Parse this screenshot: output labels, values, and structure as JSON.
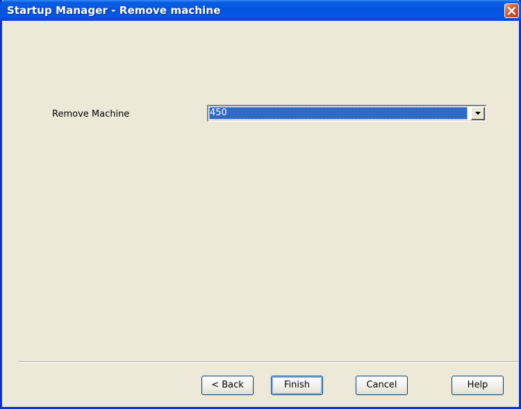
{
  "window": {
    "title": "Startup Manager - Remove machine"
  },
  "form": {
    "remove_machine_label": "Remove Machine",
    "remove_machine_value": "450"
  },
  "buttons": {
    "back": "< Back",
    "finish": "Finish",
    "cancel": "Cancel",
    "help": "Help"
  },
  "icons": {
    "close": "close-icon",
    "dropdown": "chevron-down-icon"
  },
  "colors": {
    "titlebar": "#0554e0",
    "selection": "#316ac5",
    "dialog_bg": "#ece9d8",
    "close_button": "#d8593a"
  }
}
